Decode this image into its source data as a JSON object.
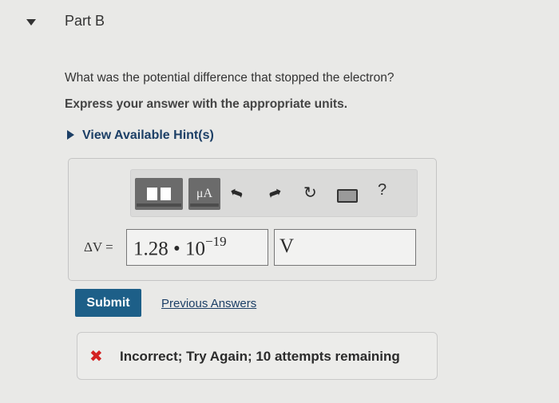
{
  "part": {
    "title": "Part B"
  },
  "question": {
    "prompt": "What was the potential difference that stopped the electron?",
    "instruction": "Express your answer with the appropriate units.",
    "hint_link": "View Available Hint(s)"
  },
  "toolbar": {
    "units_label": "μA",
    "help_label": "?"
  },
  "answer": {
    "label": "ΔV =",
    "value": "1.28 • 10",
    "exponent": "−19",
    "unit": "V"
  },
  "actions": {
    "submit_label": "Submit",
    "previous_answers_label": "Previous Answers"
  },
  "feedback": {
    "message": "Incorrect; Try Again; 10 attempts remaining",
    "status_color": "#d42222"
  },
  "colors": {
    "accent": "#1d5f88",
    "link": "#1c3f66"
  }
}
